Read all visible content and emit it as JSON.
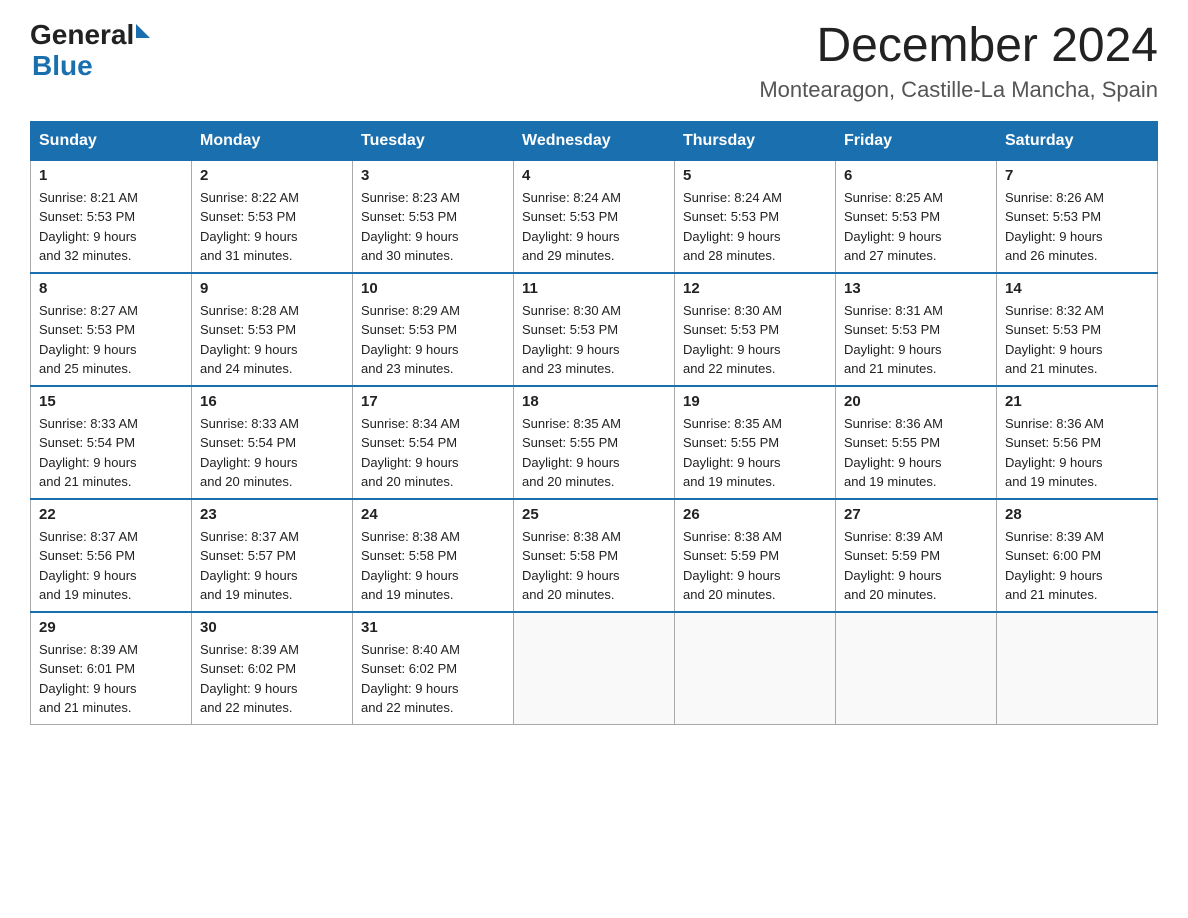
{
  "logo": {
    "general": "General",
    "blue": "Blue"
  },
  "title": {
    "month_year": "December 2024",
    "location": "Montearagon, Castille-La Mancha, Spain"
  },
  "days_of_week": [
    "Sunday",
    "Monday",
    "Tuesday",
    "Wednesday",
    "Thursday",
    "Friday",
    "Saturday"
  ],
  "weeks": [
    [
      {
        "day": "1",
        "sunrise": "8:21 AM",
        "sunset": "5:53 PM",
        "daylight": "9 hours and 32 minutes."
      },
      {
        "day": "2",
        "sunrise": "8:22 AM",
        "sunset": "5:53 PM",
        "daylight": "9 hours and 31 minutes."
      },
      {
        "day": "3",
        "sunrise": "8:23 AM",
        "sunset": "5:53 PM",
        "daylight": "9 hours and 30 minutes."
      },
      {
        "day": "4",
        "sunrise": "8:24 AM",
        "sunset": "5:53 PM",
        "daylight": "9 hours and 29 minutes."
      },
      {
        "day": "5",
        "sunrise": "8:24 AM",
        "sunset": "5:53 PM",
        "daylight": "9 hours and 28 minutes."
      },
      {
        "day": "6",
        "sunrise": "8:25 AM",
        "sunset": "5:53 PM",
        "daylight": "9 hours and 27 minutes."
      },
      {
        "day": "7",
        "sunrise": "8:26 AM",
        "sunset": "5:53 PM",
        "daylight": "9 hours and 26 minutes."
      }
    ],
    [
      {
        "day": "8",
        "sunrise": "8:27 AM",
        "sunset": "5:53 PM",
        "daylight": "9 hours and 25 minutes."
      },
      {
        "day": "9",
        "sunrise": "8:28 AM",
        "sunset": "5:53 PM",
        "daylight": "9 hours and 24 minutes."
      },
      {
        "day": "10",
        "sunrise": "8:29 AM",
        "sunset": "5:53 PM",
        "daylight": "9 hours and 23 minutes."
      },
      {
        "day": "11",
        "sunrise": "8:30 AM",
        "sunset": "5:53 PM",
        "daylight": "9 hours and 23 minutes."
      },
      {
        "day": "12",
        "sunrise": "8:30 AM",
        "sunset": "5:53 PM",
        "daylight": "9 hours and 22 minutes."
      },
      {
        "day": "13",
        "sunrise": "8:31 AM",
        "sunset": "5:53 PM",
        "daylight": "9 hours and 21 minutes."
      },
      {
        "day": "14",
        "sunrise": "8:32 AM",
        "sunset": "5:53 PM",
        "daylight": "9 hours and 21 minutes."
      }
    ],
    [
      {
        "day": "15",
        "sunrise": "8:33 AM",
        "sunset": "5:54 PM",
        "daylight": "9 hours and 21 minutes."
      },
      {
        "day": "16",
        "sunrise": "8:33 AM",
        "sunset": "5:54 PM",
        "daylight": "9 hours and 20 minutes."
      },
      {
        "day": "17",
        "sunrise": "8:34 AM",
        "sunset": "5:54 PM",
        "daylight": "9 hours and 20 minutes."
      },
      {
        "day": "18",
        "sunrise": "8:35 AM",
        "sunset": "5:55 PM",
        "daylight": "9 hours and 20 minutes."
      },
      {
        "day": "19",
        "sunrise": "8:35 AM",
        "sunset": "5:55 PM",
        "daylight": "9 hours and 19 minutes."
      },
      {
        "day": "20",
        "sunrise": "8:36 AM",
        "sunset": "5:55 PM",
        "daylight": "9 hours and 19 minutes."
      },
      {
        "day": "21",
        "sunrise": "8:36 AM",
        "sunset": "5:56 PM",
        "daylight": "9 hours and 19 minutes."
      }
    ],
    [
      {
        "day": "22",
        "sunrise": "8:37 AM",
        "sunset": "5:56 PM",
        "daylight": "9 hours and 19 minutes."
      },
      {
        "day": "23",
        "sunrise": "8:37 AM",
        "sunset": "5:57 PM",
        "daylight": "9 hours and 19 minutes."
      },
      {
        "day": "24",
        "sunrise": "8:38 AM",
        "sunset": "5:58 PM",
        "daylight": "9 hours and 19 minutes."
      },
      {
        "day": "25",
        "sunrise": "8:38 AM",
        "sunset": "5:58 PM",
        "daylight": "9 hours and 20 minutes."
      },
      {
        "day": "26",
        "sunrise": "8:38 AM",
        "sunset": "5:59 PM",
        "daylight": "9 hours and 20 minutes."
      },
      {
        "day": "27",
        "sunrise": "8:39 AM",
        "sunset": "5:59 PM",
        "daylight": "9 hours and 20 minutes."
      },
      {
        "day": "28",
        "sunrise": "8:39 AM",
        "sunset": "6:00 PM",
        "daylight": "9 hours and 21 minutes."
      }
    ],
    [
      {
        "day": "29",
        "sunrise": "8:39 AM",
        "sunset": "6:01 PM",
        "daylight": "9 hours and 21 minutes."
      },
      {
        "day": "30",
        "sunrise": "8:39 AM",
        "sunset": "6:02 PM",
        "daylight": "9 hours and 22 minutes."
      },
      {
        "day": "31",
        "sunrise": "8:40 AM",
        "sunset": "6:02 PM",
        "daylight": "9 hours and 22 minutes."
      },
      null,
      null,
      null,
      null
    ]
  ],
  "labels": {
    "sunrise": "Sunrise:",
    "sunset": "Sunset:",
    "daylight": "Daylight:"
  }
}
